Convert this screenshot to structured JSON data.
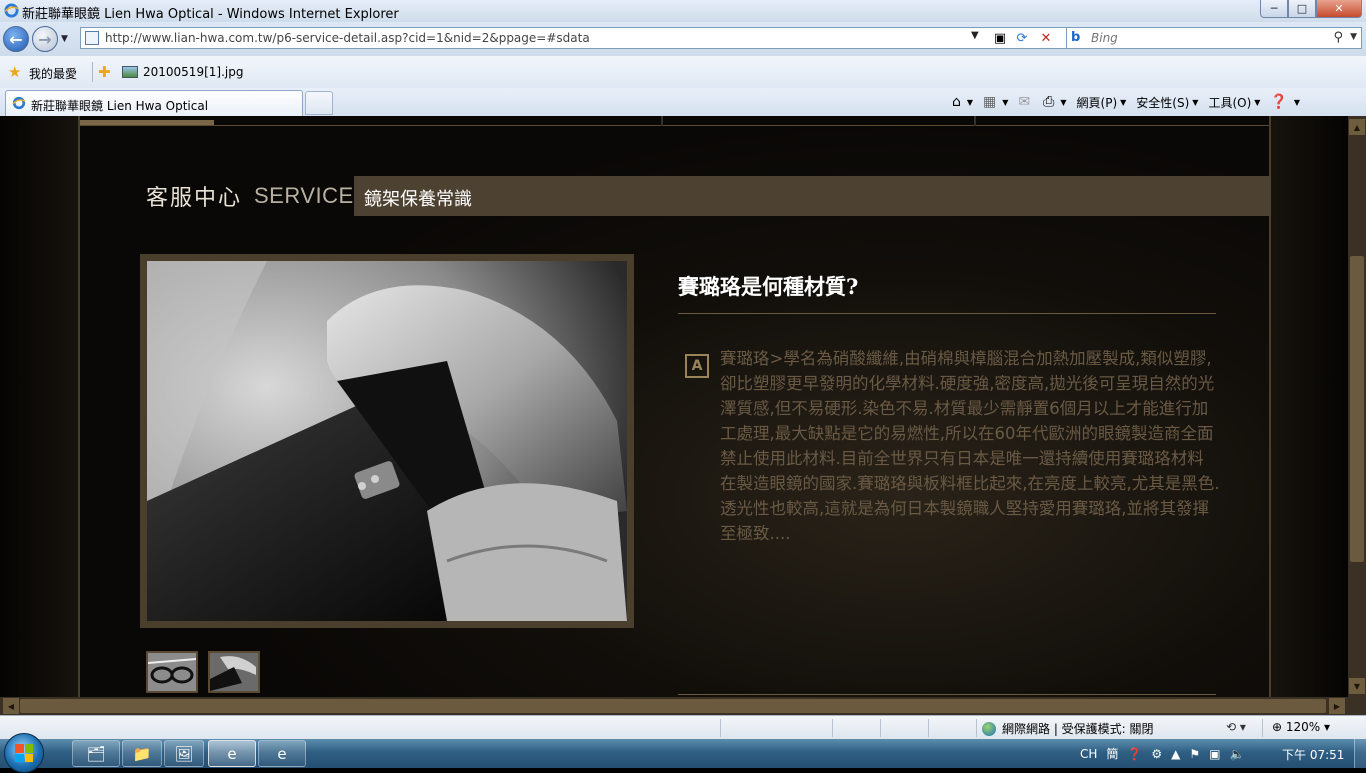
{
  "window": {
    "title": "新莊聯華眼鏡 Lien Hwa Optical - Windows Internet Explorer",
    "minimize": "─",
    "maximize": "□",
    "close": "✕"
  },
  "address_bar": {
    "url": "http://www.lian-hwa.com.tw/p6-service-detail.asp?cid=1&nid=2&ppage=#sdata",
    "compat_icon": "compat-view-icon",
    "refresh_icon": "refresh-icon",
    "stop_icon": "stop-icon"
  },
  "search": {
    "placeholder": "Bing",
    "provider_icon": "bing-icon"
  },
  "favorites_bar": {
    "favorites_label": "我的最愛",
    "items": [
      {
        "label": "20100519[1].jpg",
        "icon": "image-file-icon"
      }
    ]
  },
  "tabs": [
    {
      "label": "新莊聯華眼鏡 Lien Hwa Optical",
      "active": true
    }
  ],
  "command_bar": {
    "page_label": "網頁(P)",
    "safety_label": "安全性(S)",
    "tools_label": "工具(O)",
    "icons": [
      "home-icon",
      "rss-icon",
      "mail-icon",
      "print-icon",
      "help-icon"
    ]
  },
  "page": {
    "section_title_cn": "客服中心",
    "section_title_en": "SERVICE",
    "category": "鏡架保養常識",
    "question": "賽璐珞是何種材質?",
    "answer_badge": "A",
    "answer": "賽璐珞>學名為硝酸纖維,由硝棉與樟腦混合加熱加壓製成,類似塑膠,卻比塑膠更早發明的化學材料.硬度強,密度高,拋光後可呈現自然的光澤質感,但不易硬形.染色不易.材質最少需靜置6個月以上才能進行加工處理,最大缺點是它的易燃性,所以在60年代歐洲的眼鏡製造商全面禁止使用此材料.目前全世界只有日本是唯一還持續使用賽璐珞材料在製造眼鏡的國家.賽璐珞與板料框比起來,在亮度上較亮,尤其是黑色.透光性也較高,這就是為何日本製鏡職人堅持愛用賽璐珞,並將其發揮至極致....",
    "thumbnails": [
      {
        "name": "glasses-thumbnail"
      },
      {
        "name": "hand-frame-thumbnail"
      }
    ],
    "colors": {
      "panel_border": "#4a3e2c",
      "category_bar": "#4d4131",
      "answer_text": "#6a5a44"
    }
  },
  "status_bar": {
    "zone": "網際網路 | 受保護模式: 關閉",
    "zoom": "120%"
  },
  "taskbar": {
    "input_method": "CH",
    "ime_char": "簡",
    "time": "下午 07:51",
    "pinned": [
      "start-button",
      "libraries-icon",
      "explorer-icon",
      "photo-viewer-icon",
      "ie-icon",
      "ie-secondary-icon"
    ]
  }
}
